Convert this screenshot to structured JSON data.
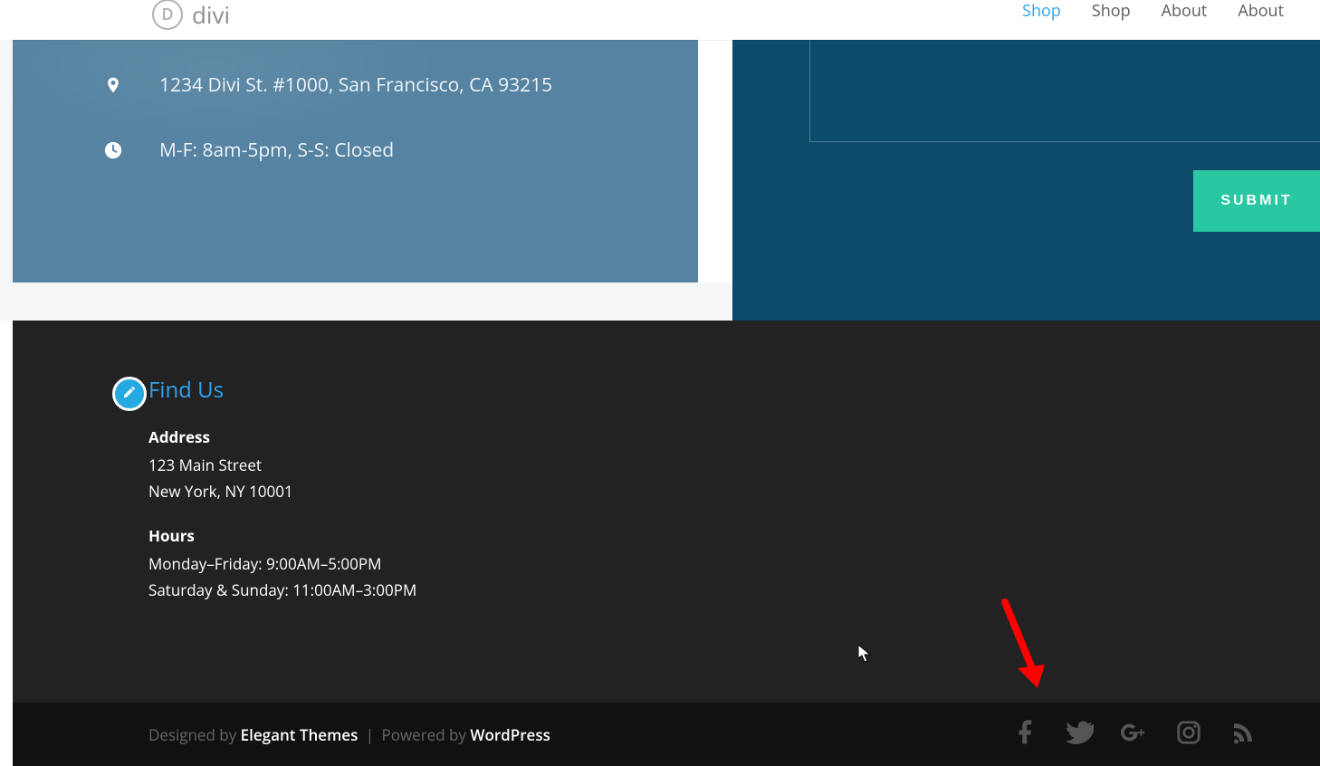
{
  "header": {
    "logo_letter": "D",
    "logo_text": "divi",
    "nav": [
      {
        "label": "Shop",
        "active": true
      },
      {
        "label": "Shop",
        "active": false
      },
      {
        "label": "About",
        "active": false
      },
      {
        "label": "About",
        "active": false
      }
    ]
  },
  "info_card": {
    "address": "1234 Divi St. #1000, San Francisco, CA 93215",
    "hours": "M-F: 8am-5pm, S-S: Closed"
  },
  "contact": {
    "submit_label": "SUBMIT"
  },
  "footer": {
    "title": "Find Us",
    "address_label": "Address",
    "address_line1": "123 Main Street",
    "address_line2": "New York, NY 10001",
    "hours_label": "Hours",
    "hours_line1": "Monday–Friday: 9:00AM–5:00PM",
    "hours_line2": "Saturday & Sunday: 11:00AM–3:00PM"
  },
  "bottom": {
    "designed_by_prefix": "Designed by ",
    "designed_by": "Elegant Themes",
    "powered_by_prefix": "Powered by ",
    "powered_by": "WordPress",
    "separator": " | ",
    "social": [
      "facebook",
      "twitter",
      "google-plus",
      "instagram",
      "rss"
    ]
  },
  "colors": {
    "accent_link": "#2ea3f2",
    "card_bg": "#5583a1",
    "contact_bg": "#0d4b6b",
    "submit_bg": "#29c7a2",
    "footer_bg": "#222222",
    "bottom_bg": "#111111",
    "annotation_arrow": "#ff0000"
  }
}
